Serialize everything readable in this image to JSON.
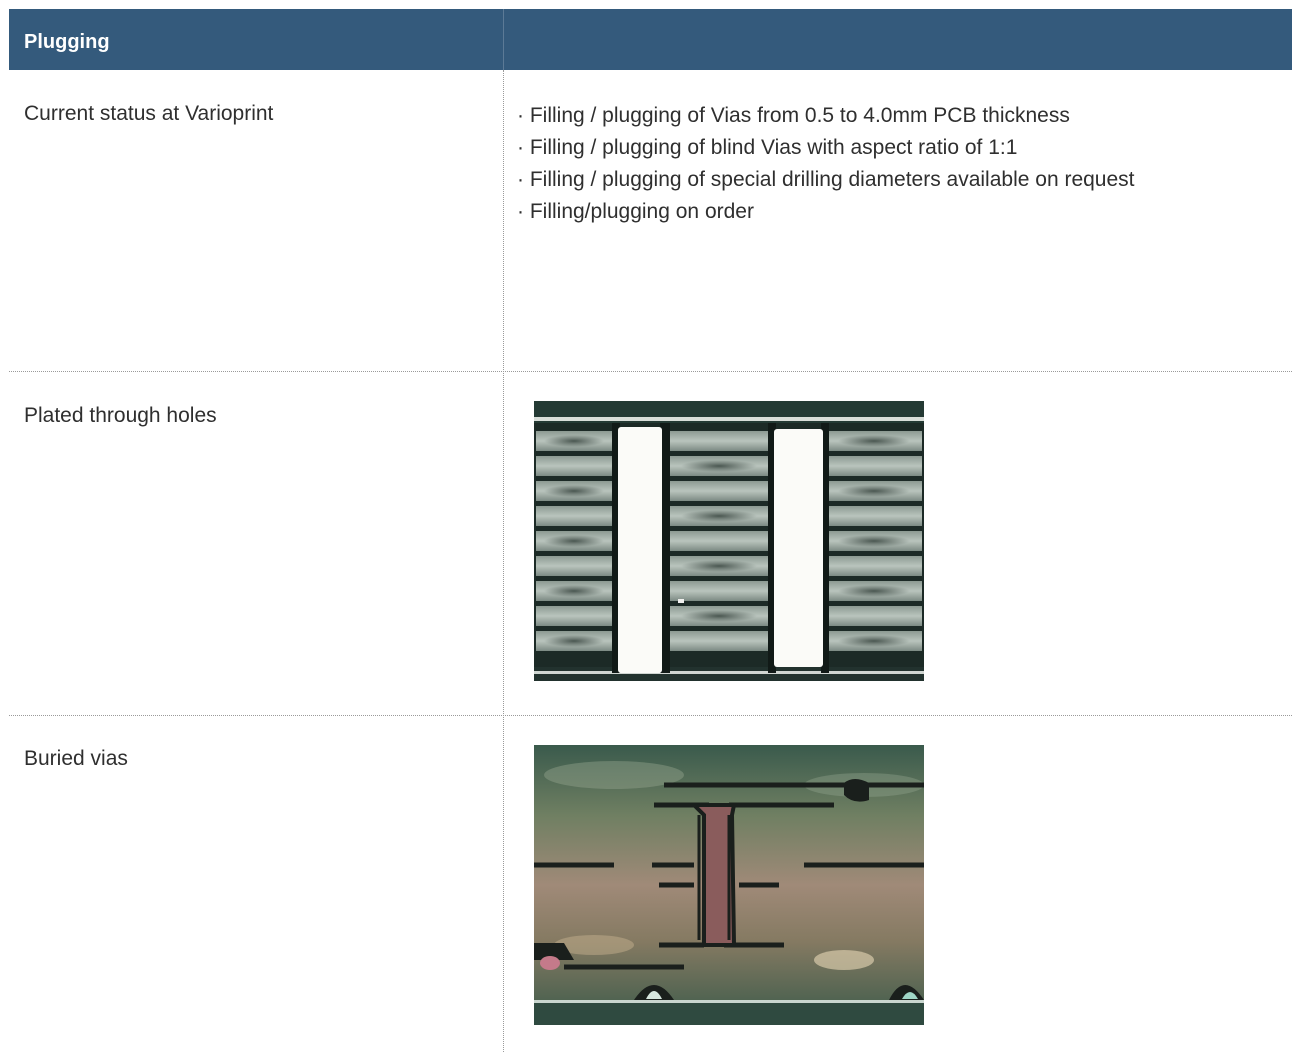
{
  "header": {
    "title": "Plugging",
    "second_col": ""
  },
  "rows": [
    {
      "label": "Current status at Varioprint",
      "bullets": [
        "Filling / plugging of Vias from 0.5 to 4.0mm PCB thickness",
        "Filling / plugging of blind Vias with aspect ratio of 1:1",
        "Filling / plugging of special drilling diameters available on request",
        "Filling/plugging on order"
      ]
    },
    {
      "label": "Plated through holes",
      "image": "pcb-cross-section-plated-through-holes"
    },
    {
      "label": "Buried vias",
      "image": "pcb-cross-section-buried-vias"
    }
  ],
  "colors": {
    "header_bg": "#345a7c",
    "header_text": "#ffffff",
    "body_text": "#2f2f2f",
    "divider": "#9a9a9a"
  }
}
